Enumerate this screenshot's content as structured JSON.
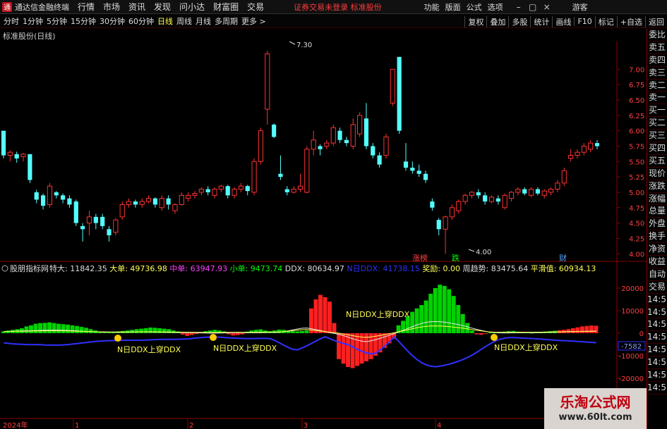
{
  "app": {
    "title": "通达信金融终端",
    "logo": "通"
  },
  "menu": [
    "行情",
    "市场",
    "资讯",
    "发现",
    "问小达",
    "财富圈",
    "交易"
  ],
  "login_tip": "证券交易未登录  标准股份",
  "system_menu": [
    "功能",
    "版面",
    "公式",
    "选项"
  ],
  "window_icons": [
    "minimize-icon",
    "restore-icon",
    "close-icon"
  ],
  "guest_label": "游客",
  "periods": [
    "分时",
    "1分钟",
    "5分钟",
    "15分钟",
    "30分钟",
    "60分钟",
    "日线",
    "周线",
    "月线",
    "多周期",
    "更多 >"
  ],
  "active_period": "日线",
  "toolbar_right": [
    "复权",
    "叠加",
    "多股",
    "统计",
    "画线",
    "F10",
    "标记",
    "+自选",
    "返回"
  ],
  "stock_title": "标准股份(日线)",
  "side_panel": [
    "委比",
    "卖五",
    "卖四",
    "卖三",
    "卖二",
    "卖一",
    "买一",
    "买二",
    "买三",
    "买四",
    "买五",
    "现价",
    "涨跌",
    "涨幅",
    "总量",
    "外盘",
    "换手",
    "净资",
    "收益",
    "自动",
    "交易",
    "14:56",
    "14:56",
    "14:56",
    "14:56",
    "14:56",
    "14:56",
    "14:56",
    "14:56"
  ],
  "price_axis": [
    "7.00",
    "6.75",
    "6.50",
    "6.25",
    "6.00",
    "5.75",
    "5.50",
    "5.25",
    "5.00",
    "4.75",
    "4.50",
    "4.25",
    "4.00"
  ],
  "high_label": "7.30",
  "low_label": "4.00",
  "event_tags": [
    {
      "text": "涨榜",
      "color": "#ff4040"
    },
    {
      "text": "跌",
      "color": "#00ff00"
    },
    {
      "text": "财",
      "color": "#4da6ff"
    }
  ],
  "indicator": {
    "name": "股朋指标网",
    "items": [
      {
        "label": "特大:",
        "value": "11842.35",
        "color": "#dddddd"
      },
      {
        "label": "大单:",
        "value": "49736.98",
        "color": "#ffff54"
      },
      {
        "label": "中单:",
        "value": "63947.93",
        "color": "#ff40ff"
      },
      {
        "label": "小单:",
        "value": "9473.74",
        "color": "#00ff00"
      },
      {
        "label": "DDX:",
        "value": "80634.97",
        "color": "#dddddd"
      },
      {
        "label": "N日DDX:",
        "value": "41738.15",
        "color": "#3030ff"
      },
      {
        "label": "奖励:",
        "value": "0.00",
        "color": "#ffff54"
      },
      {
        "label": "周趋势:",
        "value": "83475.64",
        "color": "#dddddd"
      },
      {
        "label": "平滑值:",
        "value": "60934.13",
        "color": "#ffff54"
      }
    ],
    "axis": [
      "20000",
      "10000",
      "0",
      "-10000",
      "-20000"
    ],
    "current_value": "-7582",
    "cross_label": "N日DDX上穿DDX"
  },
  "date_axis": [
    "2024年",
    "1",
    "2",
    "3",
    "4"
  ],
  "watermark": {
    "main": "乐淘公式网",
    "sub": "www.60lt.com"
  },
  "colors": {
    "up": "#ff3232",
    "down": "#54ffff",
    "green_bar": "#00d200",
    "red_bar": "#ff2020",
    "ddx_line": "#3030ff",
    "frame": "#8b0000"
  },
  "chart_data": {
    "type": "candlestick",
    "title": "标准股份(日线)",
    "ylim": [
      3.9,
      7.45
    ],
    "candles": [
      {
        "o": 6.0,
        "c": 5.6,
        "h": 6.0,
        "l": 5.55
      },
      {
        "o": 5.6,
        "c": 5.65,
        "h": 5.68,
        "l": 5.5
      },
      {
        "o": 5.62,
        "c": 5.55,
        "h": 5.66,
        "l": 5.48
      },
      {
        "o": 5.58,
        "c": 5.62,
        "h": 5.64,
        "l": 5.5
      },
      {
        "o": 5.62,
        "c": 5.2,
        "h": 5.62,
        "l": 5.15
      },
      {
        "o": 5.0,
        "c": 4.88,
        "h": 5.04,
        "l": 4.82
      },
      {
        "o": 4.95,
        "c": 4.78,
        "h": 4.98,
        "l": 4.72
      },
      {
        "o": 4.8,
        "c": 5.1,
        "h": 5.15,
        "l": 4.75
      },
      {
        "o": 5.0,
        "c": 4.95,
        "h": 5.02,
        "l": 4.9
      },
      {
        "o": 4.95,
        "c": 4.88,
        "h": 4.98,
        "l": 4.82
      },
      {
        "o": 4.9,
        "c": 4.8,
        "h": 4.95,
        "l": 4.75
      },
      {
        "o": 4.85,
        "c": 4.5,
        "h": 4.88,
        "l": 4.45
      },
      {
        "o": 4.45,
        "c": 4.4,
        "h": 4.5,
        "l": 4.2
      },
      {
        "o": 4.5,
        "c": 4.6,
        "h": 4.7,
        "l": 4.3
      },
      {
        "o": 4.6,
        "c": 4.5,
        "h": 4.65,
        "l": 4.4
      },
      {
        "o": 4.6,
        "c": 4.45,
        "h": 4.65,
        "l": 4.4
      },
      {
        "o": 4.4,
        "c": 4.3,
        "h": 4.45,
        "l": 4.2
      },
      {
        "o": 4.35,
        "c": 4.55,
        "h": 4.58,
        "l": 4.3
      },
      {
        "o": 4.6,
        "c": 4.8,
        "h": 4.85,
        "l": 4.55
      },
      {
        "o": 4.8,
        "c": 4.85,
        "h": 4.9,
        "l": 4.75
      },
      {
        "o": 4.85,
        "c": 4.8,
        "h": 4.88,
        "l": 4.75
      },
      {
        "o": 4.8,
        "c": 4.85,
        "h": 4.9,
        "l": 4.75
      },
      {
        "o": 4.85,
        "c": 4.9,
        "h": 4.95,
        "l": 4.82
      },
      {
        "o": 4.9,
        "c": 4.8,
        "h": 4.92,
        "l": 4.75
      },
      {
        "o": 4.75,
        "c": 4.9,
        "h": 4.95,
        "l": 4.7
      },
      {
        "o": 4.9,
        "c": 4.8,
        "h": 4.95,
        "l": 4.72
      },
      {
        "o": 4.7,
        "c": 4.8,
        "h": 4.82,
        "l": 4.65
      },
      {
        "o": 4.8,
        "c": 4.95,
        "h": 5.0,
        "l": 4.78
      },
      {
        "o": 4.9,
        "c": 4.95,
        "h": 5.0,
        "l": 4.85
      },
      {
        "o": 4.95,
        "c": 4.98,
        "h": 5.02,
        "l": 4.9
      },
      {
        "o": 5.0,
        "c": 5.05,
        "h": 5.08,
        "l": 4.95
      },
      {
        "o": 5.05,
        "c": 5.0,
        "h": 5.1,
        "l": 4.95
      },
      {
        "o": 4.95,
        "c": 5.05,
        "h": 5.08,
        "l": 4.9
      },
      {
        "o": 5.05,
        "c": 5.1,
        "h": 5.12,
        "l": 5.0
      },
      {
        "o": 5.1,
        "c": 4.95,
        "h": 5.12,
        "l": 4.9
      },
      {
        "o": 4.95,
        "c": 5.05,
        "h": 5.08,
        "l": 4.9
      },
      {
        "o": 5.05,
        "c": 5.1,
        "h": 5.15,
        "l": 5.0
      },
      {
        "o": 5.1,
        "c": 5.02,
        "h": 5.12,
        "l": 4.95
      },
      {
        "o": 5.0,
        "c": 5.5,
        "h": 5.55,
        "l": 4.95
      },
      {
        "o": 5.5,
        "c": 6.0,
        "h": 6.05,
        "l": 5.45
      },
      {
        "o": 6.35,
        "c": 7.25,
        "h": 7.3,
        "l": 6.1
      },
      {
        "o": 6.1,
        "c": 5.9,
        "h": 6.12,
        "l": 5.88
      },
      {
        "o": 5.3,
        "c": 5.25,
        "h": 5.6,
        "l": 5.2
      },
      {
        "o": 5.05,
        "c": 5.0,
        "h": 5.1,
        "l": 4.95
      },
      {
        "o": 5.0,
        "c": 5.05,
        "h": 5.1,
        "l": 4.98
      },
      {
        "o": 5.05,
        "c": 5.1,
        "h": 5.3,
        "l": 5.0
      },
      {
        "o": 5.0,
        "c": 5.7,
        "h": 5.75,
        "l": 4.98
      },
      {
        "o": 5.7,
        "c": 5.85,
        "h": 6.0,
        "l": 5.6
      },
      {
        "o": 5.75,
        "c": 5.7,
        "h": 5.78,
        "l": 5.6
      },
      {
        "o": 5.75,
        "c": 5.8,
        "h": 5.85,
        "l": 5.7
      },
      {
        "o": 5.8,
        "c": 6.05,
        "h": 6.1,
        "l": 5.75
      },
      {
        "o": 6.0,
        "c": 5.85,
        "h": 6.05,
        "l": 5.8
      },
      {
        "o": 5.85,
        "c": 5.8,
        "h": 5.9,
        "l": 5.75
      },
      {
        "o": 5.75,
        "c": 6.1,
        "h": 6.2,
        "l": 5.7
      },
      {
        "o": 5.95,
        "c": 6.25,
        "h": 6.3,
        "l": 5.9
      },
      {
        "o": 6.2,
        "c": 5.75,
        "h": 6.45,
        "l": 5.7
      },
      {
        "o": 5.75,
        "c": 5.6,
        "h": 5.8,
        "l": 5.55
      },
      {
        "o": 5.6,
        "c": 5.45,
        "h": 5.65,
        "l": 5.4
      },
      {
        "o": 5.6,
        "c": 5.9,
        "h": 5.95,
        "l": 5.55
      },
      {
        "o": 6.45,
        "c": 7.0,
        "h": 7.0,
        "l": 6.4
      },
      {
        "o": 7.2,
        "c": 6.0,
        "h": 7.2,
        "l": 5.95
      },
      {
        "o": 5.5,
        "c": 5.4,
        "h": 5.8,
        "l": 5.35
      },
      {
        "o": 5.4,
        "c": 5.35,
        "h": 5.5,
        "l": 5.3
      },
      {
        "o": 5.35,
        "c": 5.3,
        "h": 5.45,
        "l": 5.25
      },
      {
        "o": 5.3,
        "c": 5.2,
        "h": 5.35,
        "l": 5.15
      },
      {
        "o": 4.85,
        "c": 4.75,
        "h": 4.9,
        "l": 4.7
      },
      {
        "o": 4.55,
        "c": 4.4,
        "h": 4.58,
        "l": 4.3
      },
      {
        "o": 4.4,
        "c": 4.6,
        "h": 4.62,
        "l": 4.0
      },
      {
        "o": 4.6,
        "c": 4.75,
        "h": 4.8,
        "l": 4.55
      },
      {
        "o": 4.7,
        "c": 4.85,
        "h": 4.88,
        "l": 4.65
      },
      {
        "o": 4.85,
        "c": 4.95,
        "h": 4.98,
        "l": 4.8
      },
      {
        "o": 4.95,
        "c": 5.0,
        "h": 5.02,
        "l": 4.9
      },
      {
        "o": 5.0,
        "c": 4.95,
        "h": 5.05,
        "l": 4.9
      },
      {
        "o": 4.95,
        "c": 4.85,
        "h": 5.0,
        "l": 4.8
      },
      {
        "o": 4.85,
        "c": 4.92,
        "h": 4.95,
        "l": 4.82
      },
      {
        "o": 4.9,
        "c": 4.85,
        "h": 4.95,
        "l": 4.8
      },
      {
        "o": 4.75,
        "c": 4.95,
        "h": 4.98,
        "l": 4.72
      },
      {
        "o": 4.9,
        "c": 5.0,
        "h": 5.02,
        "l": 4.85
      },
      {
        "o": 5.0,
        "c": 5.05,
        "h": 5.08,
        "l": 4.95
      },
      {
        "o": 5.05,
        "c": 4.98,
        "h": 5.08,
        "l": 4.95
      },
      {
        "o": 4.95,
        "c": 5.05,
        "h": 5.08,
        "l": 4.92
      },
      {
        "o": 5.05,
        "c": 4.98,
        "h": 5.08,
        "l": 4.95
      },
      {
        "o": 4.95,
        "c": 5.02,
        "h": 5.05,
        "l": 4.9
      },
      {
        "o": 5.0,
        "c": 5.05,
        "h": 5.08,
        "l": 4.95
      },
      {
        "o": 5.05,
        "c": 5.15,
        "h": 5.2,
        "l": 5.0
      },
      {
        "o": 5.15,
        "c": 5.35,
        "h": 5.4,
        "l": 5.1
      },
      {
        "o": 5.55,
        "c": 5.6,
        "h": 5.7,
        "l": 5.5
      },
      {
        "o": 5.6,
        "c": 5.65,
        "h": 5.7,
        "l": 5.55
      },
      {
        "o": 5.65,
        "c": 5.75,
        "h": 5.8,
        "l": 5.6
      },
      {
        "o": 5.7,
        "c": 5.8,
        "h": 5.85,
        "l": 5.65
      },
      {
        "o": 5.8,
        "c": 5.75,
        "h": 5.85,
        "l": 5.7
      }
    ],
    "ddx_bars": [
      800,
      1200,
      1500,
      1800,
      2200,
      3000,
      3500,
      4200,
      4500,
      4600,
      4800,
      4500,
      4200,
      4000,
      3800,
      3500,
      3200,
      2800,
      2400,
      1800,
      1200,
      800,
      600,
      500,
      600,
      800,
      1000,
      1200,
      1500,
      1800,
      2000,
      2200,
      2500,
      2400,
      2200,
      2000,
      1800,
      1200,
      800,
      -600,
      -1200,
      -800,
      -300,
      500,
      900,
      1200,
      1500,
      1200,
      800,
      -500,
      -1000,
      -800,
      -500,
      700,
      1200,
      1500,
      1700,
      1200,
      900,
      1200,
      1600,
      1500,
      1200,
      900,
      800,
      1000,
      1200,
      11000,
      15000,
      17000,
      16000,
      14000,
      4500,
      -11500,
      -13500,
      -15000,
      -15500,
      -14500,
      -13500,
      -12500,
      -11500,
      -10000,
      -8500,
      -6500,
      -4500,
      -2500,
      3500,
      5500,
      7500,
      9500,
      11000,
      12500,
      14500,
      17500,
      20000,
      21500,
      21000,
      19500,
      16500,
      12500,
      8500,
      4500,
      1200,
      -500,
      -700,
      -300,
      300,
      500,
      600,
      700,
      900,
      1000,
      700,
      600,
      400,
      200,
      300,
      500,
      700,
      900,
      1100,
      1300,
      1500,
      1800,
      2200,
      2600,
      3000,
      3200,
      3400,
      3300
    ]
  }
}
